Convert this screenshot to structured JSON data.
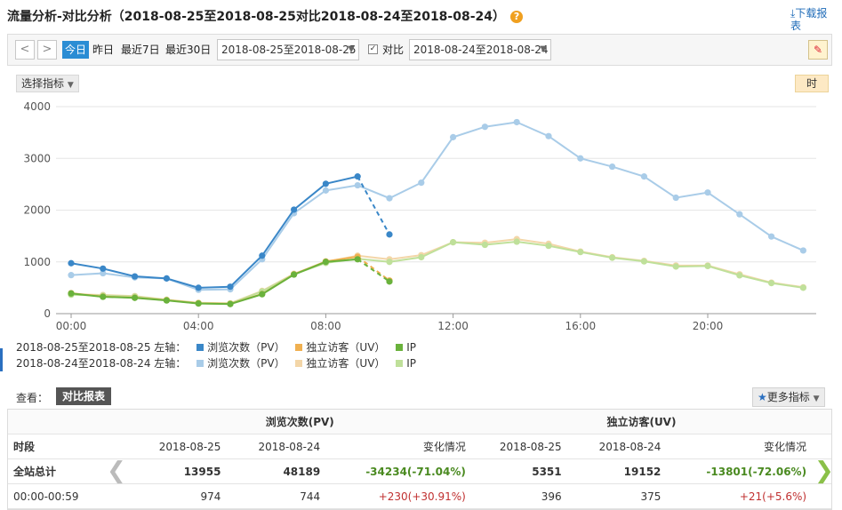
{
  "page": {
    "title": "流量分析-对比分析（2018-08-25至2018-08-25对比2018-08-24至2018-08-24）",
    "help_icon": "?",
    "download_label": "下载报表"
  },
  "toolbar": {
    "prev": "<",
    "next": ">",
    "quick_ranges": [
      "今日",
      "昨日",
      "最近7日",
      "最近30日"
    ],
    "date_range": "2018-08-25至2018-08-25",
    "compare_label": "对比",
    "compare_checked": true,
    "compare_range": "2018-08-24至2018-08-24"
  },
  "controls": {
    "metric_select": "选择指标",
    "granularity": "时"
  },
  "chart_data": {
    "type": "line",
    "x": [
      0,
      1,
      2,
      3,
      4,
      5,
      6,
      7,
      8,
      9,
      10,
      11,
      12,
      13,
      14,
      15,
      16,
      17,
      18,
      19,
      20,
      21,
      22,
      23
    ],
    "xticks": [
      "00:00",
      "04:00",
      "08:00",
      "12:00",
      "16:00",
      "20:00"
    ],
    "ylim": [
      0,
      4000
    ],
    "yticks": [
      0,
      1000,
      2000,
      3000,
      4000
    ],
    "grid": true,
    "series": [
      {
        "group": "2018-08-25至2018-08-25 左轴：",
        "name": "浏览次数（PV）",
        "color": "#3a87c8",
        "values": [
          974,
          870,
          720,
          680,
          500,
          520,
          1120,
          2010,
          2510,
          2650,
          1530
        ]
      },
      {
        "group": "2018-08-25至2018-08-25 左轴：",
        "name": "独立访客（UV）",
        "color": "#f0b050",
        "values": [
          396,
          330,
          310,
          260,
          200,
          190,
          380,
          760,
          1010,
          1100,
          640
        ]
      },
      {
        "group": "2018-08-25至2018-08-25 左轴：",
        "name": "IP",
        "color": "#6ab23c",
        "values": [
          390,
          325,
          305,
          255,
          195,
          185,
          375,
          755,
          1000,
          1050,
          620
        ]
      },
      {
        "group": "2018-08-24至2018-08-24 左轴：",
        "name": "浏览次数（PV）",
        "color": "#a9cce8",
        "values": [
          744,
          780,
          700,
          680,
          460,
          470,
          1050,
          1940,
          2380,
          2480,
          2230,
          2530,
          3410,
          3610,
          3700,
          3430,
          3000,
          2840,
          2650,
          2240,
          2340,
          1920,
          1490,
          1220
        ]
      },
      {
        "group": "2018-08-24至2018-08-24 左轴：",
        "name": "独立访客（UV）",
        "color": "#f3d6a8",
        "values": [
          375,
          360,
          340,
          270,
          210,
          200,
          440,
          770,
          1000,
          1120,
          1050,
          1130,
          1380,
          1370,
          1440,
          1350,
          1200,
          1090,
          1020,
          930,
          930,
          760,
          600,
          510
        ]
      },
      {
        "group": "2018-08-24至2018-08-24 左轴：",
        "name": "IP",
        "color": "#bfe09a",
        "values": [
          365,
          350,
          330,
          265,
          205,
          195,
          430,
          760,
          980,
          1060,
          1000,
          1090,
          1380,
          1330,
          1390,
          1310,
          1190,
          1080,
          1010,
          910,
          920,
          740,
          590,
          500
        ]
      }
    ]
  },
  "legend": {
    "group1": "2018-08-25至2018-08-25 左轴：",
    "group2": "2018-08-24至2018-08-24 左轴：",
    "pv": "浏览次数（PV）",
    "uv": "独立访客（UV）",
    "ip": "IP",
    "colors1": [
      "#3a87c8",
      "#f0b050",
      "#6ab23c"
    ],
    "colors2": [
      "#a9cce8",
      "#f3d6a8",
      "#bfe09a"
    ]
  },
  "view": {
    "label": "查看：",
    "tab": "对比报表",
    "more": "更多指标"
  },
  "table": {
    "group_pv": "浏览次数(PV)",
    "group_uv": "独立访客(UV)",
    "col_period": "时段",
    "col_d1": "2018-08-25",
    "col_d2": "2018-08-24",
    "col_change": "变化情况",
    "total": {
      "label": "全站总计",
      "pv1": "13955",
      "pv2": "48189",
      "pvc": "-34234(-71.04%)",
      "uv1": "5351",
      "uv2": "19152",
      "uvc": "-13801(-72.06%)"
    },
    "row1": {
      "label": "00:00-00:59",
      "pv1": "974",
      "pv2": "744",
      "pvc": "+230(+30.91%)",
      "uv1": "396",
      "uv2": "375",
      "uvc": "+21(+5.6%)"
    }
  }
}
